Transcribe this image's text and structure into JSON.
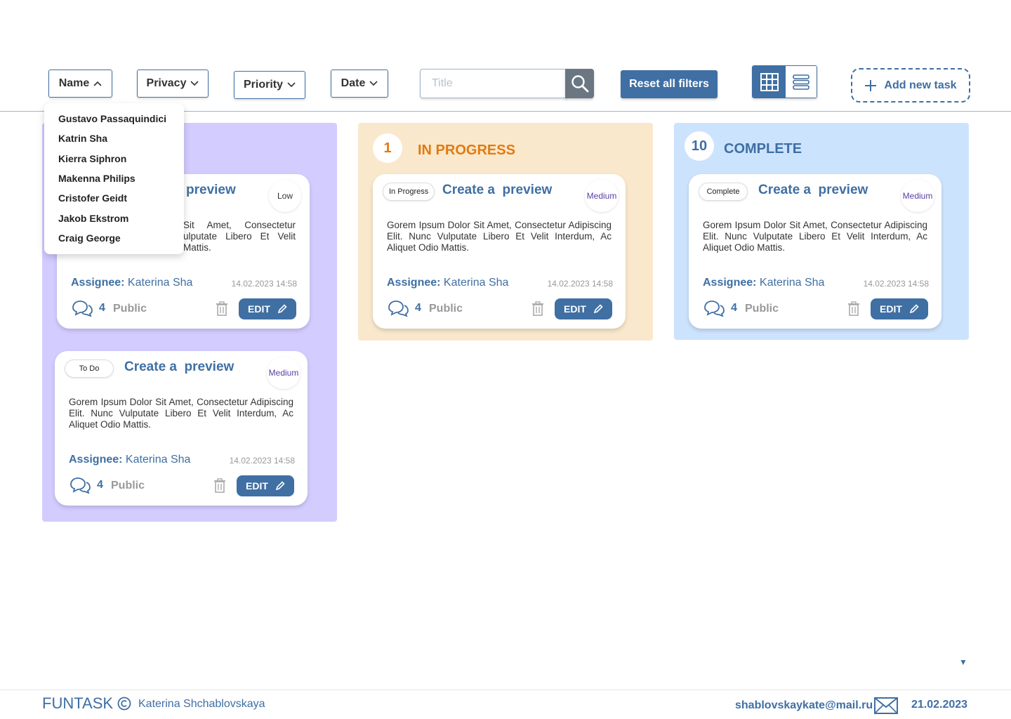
{
  "filters": {
    "name": "Name",
    "privacy": "Privacy",
    "priority": "Priority",
    "date": "Date",
    "search_placeholder": "Title",
    "reset": "Reset all filters",
    "add_task": "Add new task"
  },
  "name_dropdown": {
    "open": true,
    "items": [
      "Gustavo Passaquindici",
      "Katrin Sha",
      "Kierra Siphron",
      "Makenna Philips",
      "Cristofer Geidt",
      "Jakob Ekstrom",
      "Craig George"
    ]
  },
  "view_mode": "grid",
  "columns": [
    {
      "title": "",
      "count": "",
      "color": "#d3ccff",
      "cards": [
        {
          "status": "",
          "title": "preview",
          "priority": "Low",
          "description": "Sit Amet, Consectetur ulputate Libero Et Velit Mattis.",
          "assignee_label": "Assignee:",
          "assignee": "Katerina Sha",
          "date": "14.02.2023 14:58",
          "comments": "4",
          "privacy": "Public",
          "edit": "EDIT"
        },
        {
          "status": "To Do",
          "title": "Create a  preview",
          "priority": "Medium",
          "description": "Gorem Ipsum Dolor Sit Amet, Consectetur Adipiscing Elit. Nunc Vulputate Libero Et Velit Interdum, Ac Aliquet Odio Mattis.",
          "assignee_label": "Assignee:",
          "assignee": "Katerina Sha",
          "date": "14.02.2023 14:58",
          "comments": "4",
          "privacy": "Public",
          "edit": "EDIT"
        }
      ]
    },
    {
      "title": "IN PROGRESS",
      "count": "1",
      "color": "#fae8cc",
      "accent": "#e07b12",
      "cards": [
        {
          "status": "In Progress",
          "title": "Create a  preview",
          "priority": "Medium",
          "description": "Gorem Ipsum Dolor Sit Amet, Consectetur Adipiscing Elit. Nunc Vulputate Libero Et Velit Interdum, Ac Aliquet Odio Mattis.",
          "assignee_label": "Assignee:",
          "assignee": "Katerina Sha",
          "date": "14.02.2023 14:58",
          "comments": "4",
          "privacy": "Public",
          "edit": "EDIT"
        }
      ]
    },
    {
      "title": "COMPLETE",
      "count": "10",
      "color": "#cce3fe",
      "accent": "#3f6fa3",
      "cards": [
        {
          "status": "Complete",
          "title": "Create a  preview",
          "priority": "Medium",
          "description": "Gorem Ipsum Dolor Sit Amet, Consectetur Adipiscing Elit. Nunc Vulputate Libero Et Velit Interdum, Ac Aliquet Odio Mattis.",
          "assignee_label": "Assignee:",
          "assignee": "Katerina Sha",
          "date": "14.02.2023 14:58",
          "comments": "4",
          "privacy": "Public",
          "edit": "EDIT"
        }
      ]
    }
  ],
  "footer": {
    "brand": "FUNTASK",
    "author": "Katerina Shchablovskaya",
    "email": "shablovskaykate@mail.ru",
    "date": "21.02.2023"
  },
  "icons": [
    "chevron-up-icon",
    "chevron-down-icon",
    "search-icon",
    "grid-icon",
    "list-icon",
    "plus-icon",
    "comments-icon",
    "trash-icon",
    "pencil-icon",
    "copyright-icon",
    "mail-icon"
  ],
  "colors": {
    "primary": "#3f6fa3",
    "medium_priority": "#5b3ea8"
  }
}
